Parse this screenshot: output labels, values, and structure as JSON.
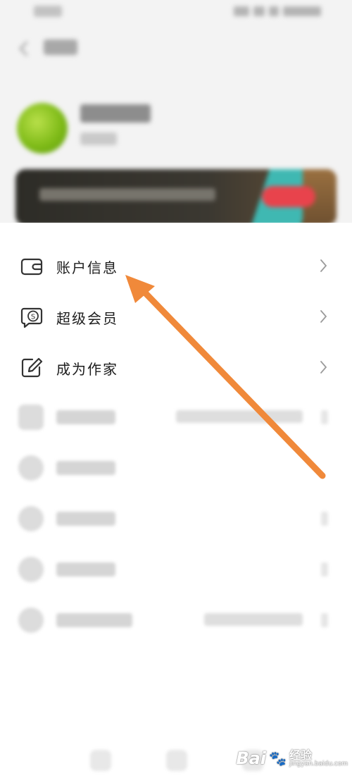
{
  "menu": {
    "items": [
      {
        "label": "账户信息",
        "icon": "wallet-icon"
      },
      {
        "label": "超级会员",
        "icon": "vip-coin-icon"
      },
      {
        "label": "成为作家",
        "icon": "edit-icon"
      }
    ]
  },
  "annotation": {
    "arrow_color": "#f0893a"
  },
  "watermark": {
    "brand": "Bai",
    "cn": "经验",
    "url": "jingyan.baidu.com"
  },
  "colors": {
    "avatar": "#7fbb18",
    "vip_button": "#e8434c",
    "banner_accent": "#3fb8b2"
  }
}
